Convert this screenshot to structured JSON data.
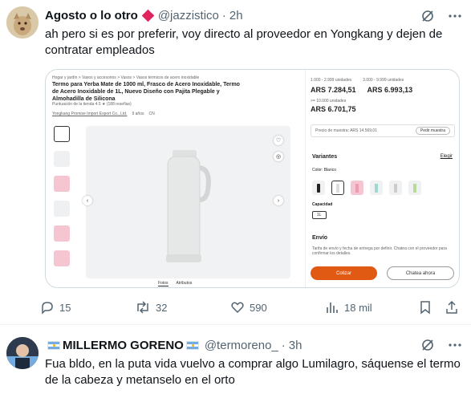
{
  "tweets": [
    {
      "author_name": "Agosto o lo otro",
      "handle": "@jazzistico",
      "separator": "·",
      "time": "2h",
      "text": "ah pero si es por preferir, voy directo al proveedor en Yongkang y dejen de contratar empleados",
      "media": {
        "breadcrumb": "Hogar y jardín  >  Vasos y accesorios  >  Vasos  >  Vasos térmicos de acero inoxidable",
        "product_title": "Termo para Yerba Mate de 1000 ml, Frasco de Acero Inoxidable, Termo de Acero Inoxidable de 1L, Nuevo Diseño con Pajita Plegable y Almohadilla de Silicona",
        "rating_text": "Puntuación de la tienda 4.5 ★ (188 reseñas)",
        "supplier": "Yongkang Promise Import Export Co., Ltd.",
        "supplier_years": "9 años",
        "supplier_country": "CN",
        "tab_photos": "Fotos",
        "tab_attributes": "Atributos",
        "tier1_range": "1.000 - 2.999 unidades",
        "tier2_range": "3.000 - 9.999 unidades",
        "price1": "ARS 7.284,51",
        "price2": "ARS 6.993,13",
        "tier3_range": ">= 10.000 unidades",
        "price3": "ARS 6.701,75",
        "sample_price": "Precio de muestra: ARS 14.569,01",
        "sample_button": "Pedir muestra",
        "variants_label": "Variantes",
        "choose_link": "Elegir",
        "color_label": "Color: Blanco",
        "capacity_label": "Capacidad",
        "capacity_value": "1L",
        "shipping_label": "Envío",
        "shipping_text": "Tarifa de envío y fecha de entrega por definir. Chatea con el proveedor para confirmar los detalles.",
        "quote_button": "Cotizar",
        "chat_button": "Chatea ahora"
      },
      "stats": {
        "replies": "15",
        "retweets": "32",
        "likes": "590",
        "views": "18 mil"
      }
    },
    {
      "author_name": "MILLERMO GORENO",
      "handle": "@termoreno_",
      "separator": "·",
      "time": "3h",
      "text": "Fua bldo, en la puta vida vuelvo a comprar algo Lumilagro, sáquense el termo de la cabeza y metanselo en el orto"
    }
  ],
  "colors": {
    "text_primary": "#0f1419",
    "text_secondary": "#536471",
    "border": "#cfd9de",
    "accent_orange": "#e15a14",
    "badge_red": "#e0245e"
  }
}
